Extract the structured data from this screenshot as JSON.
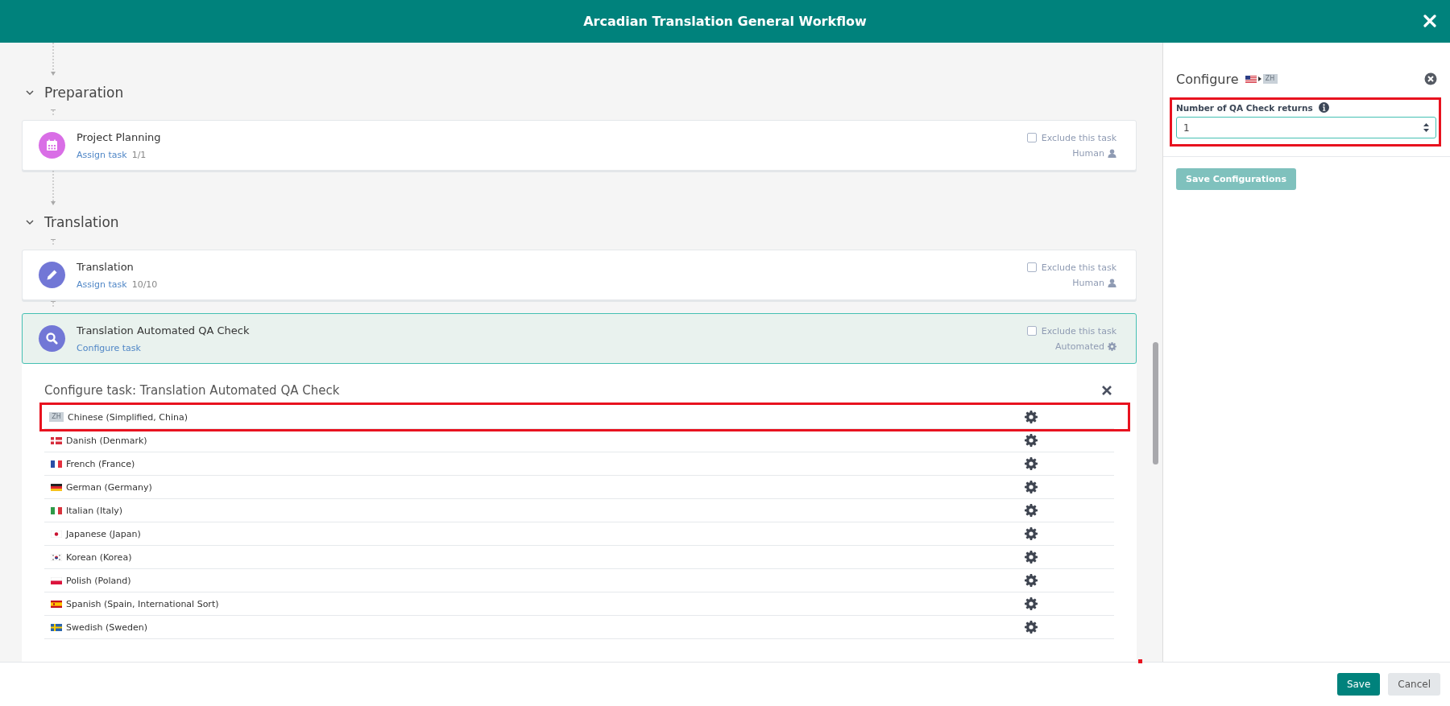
{
  "window": {
    "title": "Arcadian Translation General Workflow"
  },
  "sections": [
    {
      "title": "Preparation",
      "expanded": true,
      "tasks": [
        {
          "title": "Project Planning",
          "kind": "calendar",
          "color": "#d96ee6",
          "link": "Assign task",
          "count": "1/1",
          "exclude_label": "Exclude this task",
          "excluded": false,
          "mode": {
            "text": "Human",
            "kind": "human"
          },
          "selected": false
        }
      ]
    },
    {
      "title": "Translation",
      "expanded": true,
      "tasks": [
        {
          "title": "Translation",
          "kind": "pencil",
          "color": "#7277d6",
          "link": "Assign task",
          "count": "10/10",
          "exclude_label": "Exclude this task",
          "excluded": false,
          "mode": {
            "text": "Human",
            "kind": "human"
          },
          "selected": false
        },
        {
          "title": "Translation Automated QA Check",
          "kind": "search",
          "color": "#7277d6",
          "link": "Configure task",
          "exclude_label": "Exclude this task",
          "excluded": false,
          "mode": {
            "text": "Automated",
            "kind": "automated"
          },
          "selected": true
        }
      ]
    }
  ],
  "task_config": {
    "title": "Configure task: Translation Automated QA Check",
    "languages": [
      {
        "name": "Chinese (Simplified, China)",
        "kind": "code",
        "code": "ZH",
        "highlighted": true
      },
      {
        "name": "Danish (Denmark)",
        "kind": "dk",
        "highlighted": false
      },
      {
        "name": "French (France)",
        "kind": "fr",
        "highlighted": false
      },
      {
        "name": "German (Germany)",
        "kind": "de",
        "highlighted": false
      },
      {
        "name": "Italian (Italy)",
        "kind": "it",
        "highlighted": false
      },
      {
        "name": "Japanese (Japan)",
        "kind": "jp",
        "highlighted": false
      },
      {
        "name": "Korean (Korea)",
        "kind": "kr",
        "highlighted": false
      },
      {
        "name": "Polish (Poland)",
        "kind": "pl",
        "highlighted": false
      },
      {
        "name": "Spanish (Spain, International Sort)",
        "kind": "es",
        "highlighted": false
      },
      {
        "name": "Swedish (Sweden)",
        "kind": "se",
        "highlighted": false
      }
    ]
  },
  "side_panel": {
    "title": "Configure",
    "source": {
      "kind": "us"
    },
    "target": {
      "kind": "code",
      "code": "ZH"
    },
    "field": {
      "label": "Number of QA Check returns",
      "value": "1",
      "highlighted": true
    },
    "button": "Save Configurations"
  },
  "footer": {
    "buttons": [
      {
        "label": "Save",
        "kind": "primary"
      },
      {
        "label": "Cancel",
        "kind": "secondary"
      }
    ]
  }
}
